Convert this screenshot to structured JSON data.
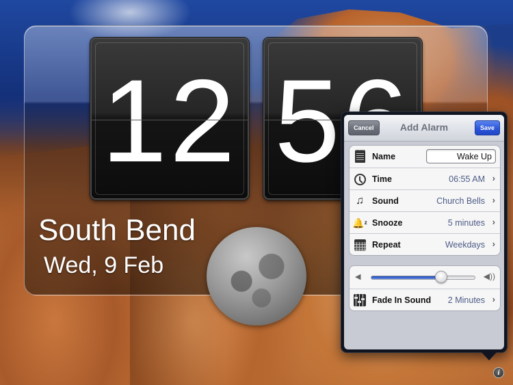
{
  "clock": {
    "hours": "12",
    "minutes": "56",
    "city": "South Bend",
    "date": "Wed, 9 Feb",
    "moon_icon": "full-moon"
  },
  "add_alarm": {
    "title": "Add Alarm",
    "cancel_label": "Cancel",
    "save_label": "Save",
    "rows": [
      {
        "icon": "notepad-icon",
        "label": "Name",
        "value": "Wake Up"
      },
      {
        "icon": "clock-icon",
        "label": "Time",
        "value": "06:55 AM"
      },
      {
        "icon": "music-note-icon",
        "label": "Sound",
        "value": "Church Bells"
      },
      {
        "icon": "snooze-bell-icon",
        "label": "Snooze",
        "value": "5 minutes"
      },
      {
        "icon": "calendar-icon",
        "label": "Repeat",
        "value": "Weekdays"
      }
    ],
    "volume": {
      "level_percent": 67,
      "low_icon": "◀",
      "high_icon": "◀))"
    },
    "fade": {
      "icon": "mixer-icon",
      "label": "Fade In Sound",
      "value": "2 Minutes"
    },
    "chevron": "›"
  },
  "info_button": {
    "glyph": "i"
  },
  "colors": {
    "save_button": "#2d57d9",
    "cancel_button": "#6a6f79",
    "value_text": "#4d5c85",
    "slider_fill": "#1c47b8"
  }
}
